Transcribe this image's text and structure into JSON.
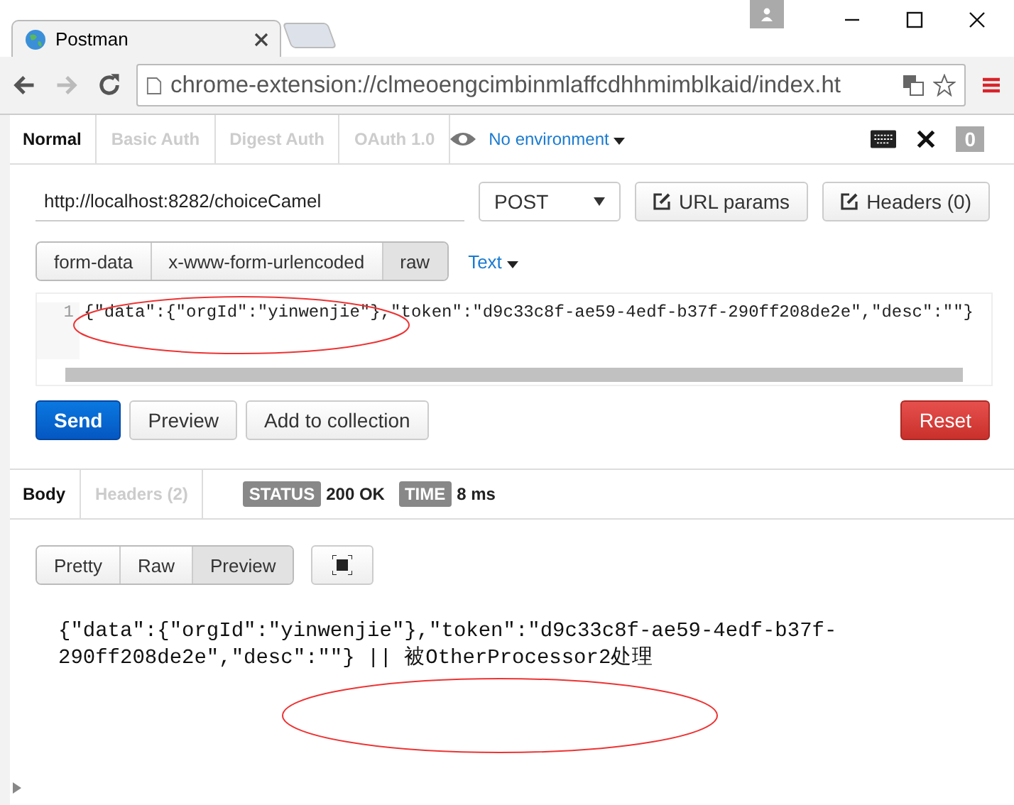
{
  "browser": {
    "tab_title": "Postman",
    "address": "chrome-extension://clmeoengcimbinmlaffcdhhmimblkaid/index.ht"
  },
  "auth_tabs": [
    {
      "label": "Normal",
      "selected": true
    },
    {
      "label": "Basic Auth",
      "selected": false
    },
    {
      "label": "Digest Auth",
      "selected": false
    },
    {
      "label": "OAuth 1.0",
      "selected": false
    }
  ],
  "environment": "No environment",
  "counter": "0",
  "request": {
    "url": "http://localhost:8282/choiceCamel",
    "method": "POST",
    "buttons": [
      "URL params",
      "Headers (0)"
    ]
  },
  "body_types": [
    {
      "label": "form-data",
      "selected": false
    },
    {
      "label": "x-www-form-urlencoded",
      "selected": false
    },
    {
      "label": "raw",
      "selected": true
    }
  ],
  "body_format": "Text",
  "editor": {
    "line_number": "1",
    "code": "{\"data\":{\"orgId\":\"yinwenjie\"},\"token\":\"d9c33c8f-ae59-4edf-b37f-290ff208de2e\",\"desc\":\"\"}"
  },
  "actions": {
    "send": "Send",
    "preview": "Preview",
    "add": "Add to collection",
    "reset": "Reset"
  },
  "response_tabs": [
    {
      "label": "Body",
      "selected": true
    },
    {
      "label": "Headers (2)",
      "selected": false
    }
  ],
  "status": {
    "label": "STATUS",
    "value": "200 OK"
  },
  "time": {
    "label": "TIME",
    "value": "8 ms"
  },
  "view_modes": [
    {
      "label": "Pretty",
      "selected": false
    },
    {
      "label": "Raw",
      "selected": false
    },
    {
      "label": "Preview",
      "selected": true
    }
  ],
  "response_body": [
    "{\"data\":{\"orgId\":\"yinwenjie\"},\"token\":\"d9c33c8f-ae59-4edf-b37f-",
    "290ff208de2e\",\"desc\":\"\"} || 被OtherProcessor2处理"
  ]
}
